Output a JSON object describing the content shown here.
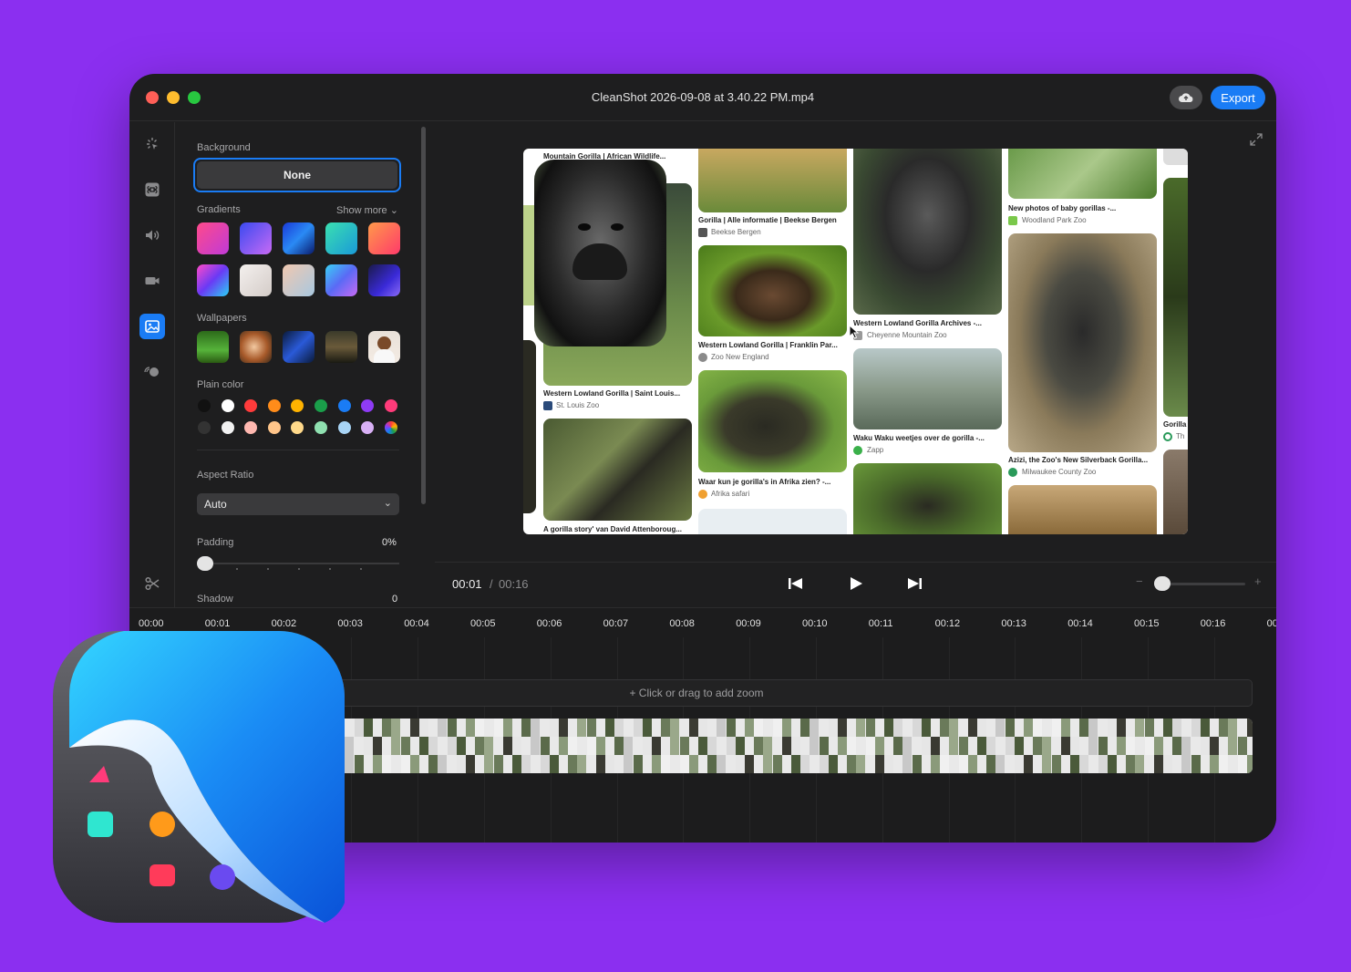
{
  "window": {
    "title": "CleanShot 2026-09-08 at 3.40.22 PM.mp4",
    "export_label": "Export"
  },
  "sidebar": {
    "background_label": "Background",
    "none_label": "None",
    "gradients_label": "Gradients",
    "show_more_label": "Show more",
    "wallpapers_label": "Wallpapers",
    "plain_color_label": "Plain color",
    "aspect_ratio_label": "Aspect Ratio",
    "aspect_ratio_value": "Auto",
    "padding_label": "Padding",
    "padding_value": "0%",
    "shadow_label": "Shadow",
    "shadow_value": "0",
    "gradients": [
      "#e63a8c",
      "#7a5cf0",
      "#1f4fd8",
      "#2fd3b0",
      "#ff6a4d",
      "#b44cf0",
      "#e8e4e2",
      "#c9d8e2",
      "#5aa8f5",
      "#2a1f7a"
    ],
    "plain_colors": [
      "#111111",
      "#ffffff",
      "#ff3b3b",
      "#ff8c1a",
      "#ffb300",
      "#1a9e4a",
      "#1a7cf5",
      "#8e3bf5",
      "#ff3b7a",
      "#333333",
      "#f2f2f2",
      "#ffb8b0",
      "#ffc58a",
      "#ffd98a",
      "#8fe0b0",
      "#a8d4f5",
      "#d8b0f5",
      "#ffffff"
    ]
  },
  "preview": {
    "cards": [
      {
        "title": "Mountain Gorilla | African Wildlife...",
        "source": ""
      },
      {
        "title": "Western Lowland Gorilla | Saint Louis...",
        "source": "St. Louis Zoo"
      },
      {
        "title": "A gorilla story' van David Attenboroug...",
        "source": ""
      },
      {
        "title": "Gorilla | Alle informatie | Beekse Bergen",
        "source": "Beekse Bergen"
      },
      {
        "title": "Western Lowland Gorilla | Franklin Par...",
        "source": "Zoo New England"
      },
      {
        "title": "Waar kun je gorilla's in Afrika zien? -...",
        "source": "Afrika safari"
      },
      {
        "title": "Western Lowland Gorilla Archives -...",
        "source": "Cheyenne Mountain Zoo"
      },
      {
        "title": "Waku Waku weetjes over de gorilla -...",
        "source": "Zapp"
      },
      {
        "title": "New photos of baby gorillas -...",
        "source": "Woodland Park Zoo"
      },
      {
        "title": "Azizi, the Zoo's New Silverback Gorilla...",
        "source": "Milwaukee County Zoo"
      },
      {
        "title": "Gorilla",
        "source": "Th"
      }
    ]
  },
  "playback": {
    "current": "00:01",
    "separator": "/",
    "total": "00:16",
    "zoom_minus": "−",
    "zoom_plus": "+",
    "zoom_level": 0.0
  },
  "timeline": {
    "ruler": [
      "00:00",
      "00:01",
      "00:02",
      "00:03",
      "00:04",
      "00:05",
      "00:06",
      "00:07",
      "00:08",
      "00:09",
      "00:10",
      "00:11",
      "00:12",
      "00:13",
      "00:14",
      "00:15",
      "00:16",
      "00"
    ],
    "zoom_hint": "+ Click or drag to add zoom"
  }
}
